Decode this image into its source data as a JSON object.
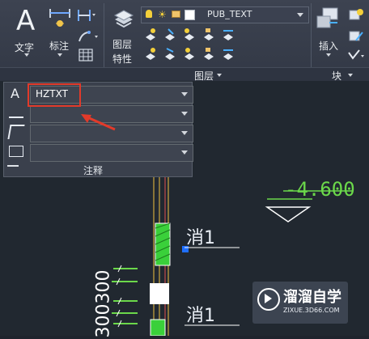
{
  "ribbon": {
    "text_tool": {
      "label": "文字"
    },
    "dim_tool": {
      "label": "标注"
    },
    "layer_props": {
      "line1": "图层",
      "line2": "特性"
    },
    "layer_dropdown": {
      "value": "PUB_TEXT"
    },
    "insert_tool": {
      "label": "插入"
    },
    "panels": {
      "layer": "图层",
      "block": "块"
    }
  },
  "annotation_panel": {
    "text_style": {
      "value": "HZTXT"
    },
    "title": "注释"
  },
  "drawing": {
    "elevation": "-4.600",
    "text_top": "消1",
    "text_bottom": "消1",
    "dims": "300300"
  },
  "watermark": {
    "title": "溜溜自学",
    "url": "ZIXUE.3D66.COM"
  },
  "colors": {
    "accent_green": "#6bd84a",
    "annotation_red": "#e23a2a",
    "layer_blue": "#4a7fd8"
  }
}
